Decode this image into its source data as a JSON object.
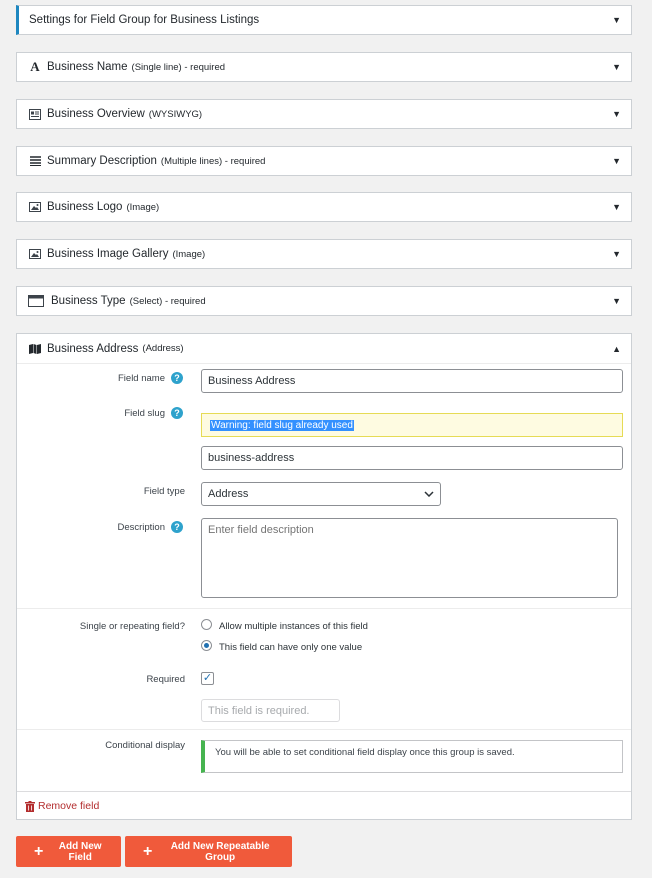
{
  "settings_panel": {
    "title": "Settings for Field Group for Business Listings"
  },
  "fields": [
    {
      "name": "Business Name",
      "meta": "(Single line) - required",
      "icon": "text-a-icon"
    },
    {
      "name": "Business Overview",
      "meta": "(WYSIWYG)",
      "icon": "editor-icon"
    },
    {
      "name": "Summary Description",
      "meta": "(Multiple lines) - required",
      "icon": "lines-icon"
    },
    {
      "name": "Business Logo",
      "meta": "(Image)",
      "icon": "image-icon"
    },
    {
      "name": "Business Image Gallery",
      "meta": "(Image)",
      "icon": "image-icon"
    },
    {
      "name": "Business Type",
      "meta": "(Select) - required",
      "icon": "window-icon"
    }
  ],
  "expanded_field": {
    "name": "Business Address",
    "meta": "(Address)",
    "icon": "map-icon",
    "labels": {
      "field_name": "Field name",
      "field_slug": "Field slug",
      "field_type": "Field type",
      "description": "Description",
      "single_or_repeating": "Single or repeating field?",
      "required": "Required",
      "conditional_display": "Conditional display"
    },
    "values": {
      "field_name": "Business Address",
      "slug_warning": "Warning: field slug already used",
      "field_slug": "business-address",
      "field_type": "Address",
      "description_placeholder": "Enter field description",
      "required_message_placeholder": "This field is required."
    },
    "radio_options": [
      {
        "label": "Allow multiple instances of this field",
        "checked": false
      },
      {
        "label": "This field can have only one value",
        "checked": true
      }
    ],
    "required_checked": true,
    "conditional_notice": "You will be able to set conditional field display once this group is saved.",
    "remove_label": "Remove field"
  },
  "buttons": {
    "add_new_field": "Add New Field",
    "add_new_repeatable_group": "Add New Repeatable Group"
  },
  "colors": {
    "accent": "#f05a3b",
    "link_red": "#b32d2e",
    "help_blue": "#2ea2cc",
    "settings_border": "#1e87c0",
    "notice_green": "#46b450"
  }
}
